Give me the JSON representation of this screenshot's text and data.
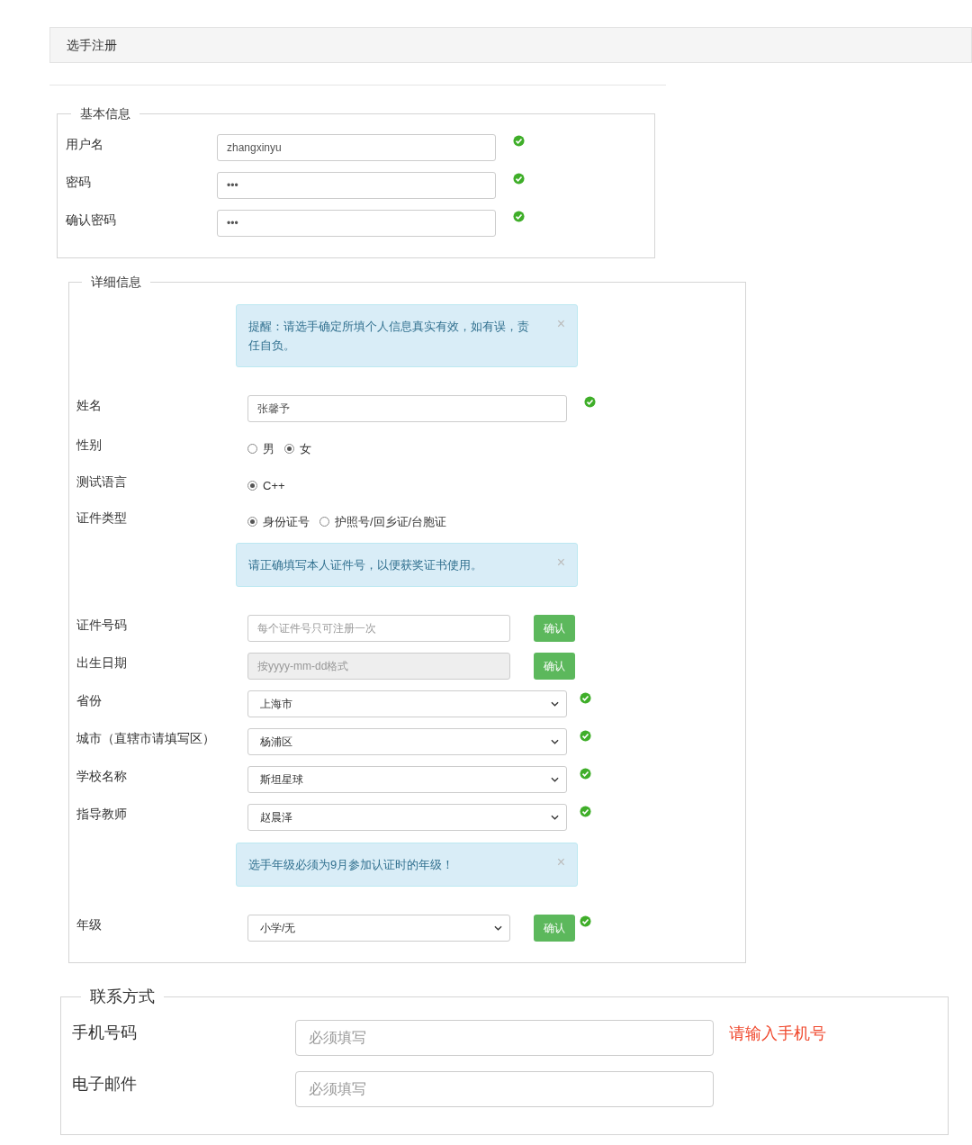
{
  "header": {
    "title": "选手注册"
  },
  "sections": [
    {
      "legend": "基本信息",
      "rows": [
        {
          "kind": "input",
          "label": "用户名",
          "value": "zhangxinyu",
          "valid": true
        },
        {
          "kind": "input",
          "label": "密码",
          "value": "•••",
          "valid": true
        },
        {
          "kind": "input",
          "label": "确认密码",
          "value": "•••",
          "valid": true
        }
      ]
    },
    {
      "legend": "详细信息",
      "rows": [
        {
          "kind": "alert",
          "text": "提醒：请选手确定所填个人信息真实有效，如有误，责任自负。",
          "close": "×"
        },
        {
          "kind": "input",
          "label": "姓名",
          "value": "张馨予",
          "valid": true
        },
        {
          "kind": "radio",
          "label": "性别",
          "options": [
            {
              "label": "男",
              "selected": false
            },
            {
              "label": "女",
              "selected": true
            }
          ]
        },
        {
          "kind": "radio",
          "label": "测试语言",
          "options": [
            {
              "label": "C++",
              "selected": true
            }
          ]
        },
        {
          "kind": "radio",
          "label": "证件类型",
          "options": [
            {
              "label": "身份证号",
              "selected": true
            },
            {
              "label": "护照号/回乡证/台胞证",
              "selected": false
            }
          ]
        },
        {
          "kind": "alert",
          "text": "请正确填写本人证件号，以便获奖证书使用。",
          "close": "×"
        },
        {
          "kind": "input_button",
          "label": "证件号码",
          "placeholder": "每个证件号只可注册一次",
          "disabled": false,
          "button": "确认",
          "valid": false
        },
        {
          "kind": "input_button",
          "label": "出生日期",
          "placeholder": "按yyyy-mm-dd格式",
          "disabled": true,
          "button": "确认",
          "valid": false
        },
        {
          "kind": "select",
          "label": "省份",
          "value": "上海市",
          "valid": true
        },
        {
          "kind": "select",
          "label": "城市（直辖市请填写区）",
          "value": "杨浦区",
          "valid": true
        },
        {
          "kind": "select",
          "label": "学校名称",
          "value": "斯坦星球",
          "valid": true
        },
        {
          "kind": "select",
          "label": "指导教师",
          "value": "赵晨泽",
          "valid": true
        },
        {
          "kind": "alert",
          "text": "选手年级必须为9月参加认证时的年级！",
          "close": "×"
        },
        {
          "kind": "select_button",
          "label": "年级",
          "value": "小学/无",
          "button": "确认",
          "valid": true
        }
      ]
    },
    {
      "legend": "联系方式",
      "rows": [
        {
          "kind": "input",
          "label": "手机号码",
          "placeholder": "必须填写",
          "error": "请输入手机号",
          "valid": false
        },
        {
          "kind": "input",
          "label": "电子邮件",
          "placeholder": "必须填写",
          "valid": false
        }
      ]
    }
  ]
}
